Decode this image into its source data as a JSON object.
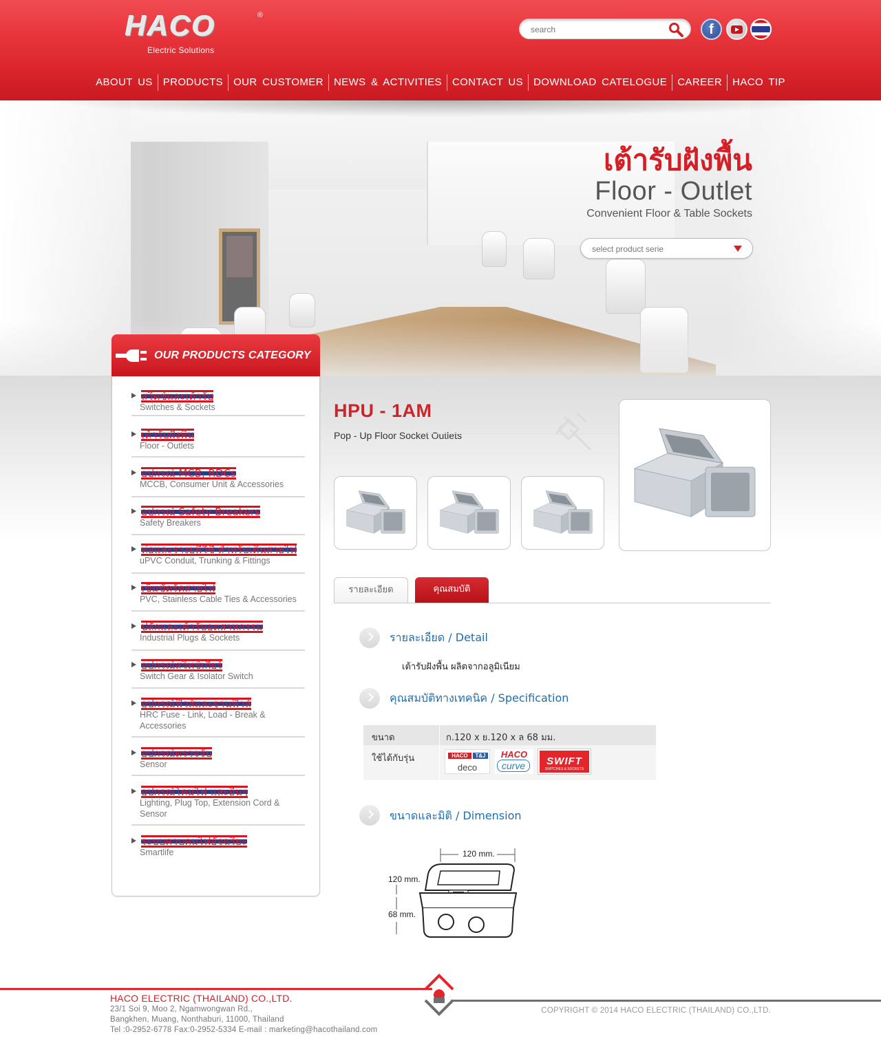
{
  "brand": {
    "logo_text": "HACO",
    "tagline": "Electric Solutions"
  },
  "search": {
    "placeholder": "search"
  },
  "nav": [
    "ABOUT US",
    "PRODUCTS",
    "OUR CUSTOMER",
    "NEWS & ACTIVITIES",
    "CONTACT US",
    "DOWNLOAD CATELOGUE",
    "CAREER",
    "HACO TIP"
  ],
  "hero": {
    "title_th": "เต้ารับฝังพื้น",
    "title_en": "Floor - Outlet",
    "subtitle": "Convenient Floor & Table Sockets",
    "select_label": "select product serie"
  },
  "sidebar": {
    "title": "OUR PRODUCTS CATEGORY",
    "items": [
      {
        "th": "สวิตช์และเต้ารับ",
        "en": "Switches & Sockets"
      },
      {
        "th": "เต้ารับฝังพื้น",
        "en": "Floor - Outlets"
      },
      {
        "th": "อุปกรณ์ MCB, RDCs",
        "en": "MCCB, Consumer Unit & Accessories"
      },
      {
        "th": "อุปกรณ์ Safety Breakers",
        "en": "Safety Breakers"
      },
      {
        "th": "ท่อและรางยูพีวีซี สำหรับเดินสายไฟ",
        "en": "uPVC Conduit, Trunking & Fittings"
      },
      {
        "th": "เข็มขัดรัดสายไฟ",
        "en": "PVC, Stainless Cable Ties & Accessories"
      },
      {
        "th": "ปลั๊กและเต้ารับอุตสาหกรรม",
        "en": "Industrial Plugs & Sockets"
      },
      {
        "th": "อุปกรณ์สวิทช์เกียร์",
        "en": "Switch Gear & Isolator Switch"
      },
      {
        "th": "อุปกรณ์ฟิวส์และฐานฟิวส์",
        "en": "HRC Fuse - Link, Load - Break & Accessories"
      },
      {
        "th": "อุปกรณ์ตรวจจับ",
        "en": "Sensor"
      },
      {
        "th": "อุปกรณ์โคมไฟ และอื่นๆ",
        "en": "Lighting, Plug Top, Extension Cord & Sensor"
      },
      {
        "th": "ระบบควบคุมไฟอัจฉริยะ",
        "en": "Smartlife"
      }
    ]
  },
  "product": {
    "code": "HPU - 1AM",
    "description": "Pop - Up Floor Socket Outlets"
  },
  "tabs": [
    "รายละเอียด",
    "คุณสมบัติ"
  ],
  "sections": {
    "detail_title": "รายละเอียด /  Detail",
    "detail_text": "เต้ารับฝังพื้น ผลิตจากอลูมิเนียม",
    "spec_title": "คุณสมบัติทางเทคนิค / Specification",
    "dimension_title": "ขนาดและมิติ / Dimension"
  },
  "spec": {
    "size_label": "ขนาด",
    "size_value": "ก.120 x ย.120 x ล 68 มม.",
    "compat_label": "ใช้ได้กับรุ่น",
    "brands": [
      "HACO",
      "T&J",
      "deco",
      "HACO",
      "curve",
      "SWIFT",
      "SWITCHES & SOCKETS"
    ]
  },
  "dimension": {
    "width": "120 mm.",
    "depth": "120 mm.",
    "height": "68 mm."
  },
  "footer": {
    "company": "HACO ELECTRIC (THAILAND) CO.,LTD.",
    "address1": "23/1 Soi 9, Moo 2, Ngamwongwan Rd.,",
    "address2": "Bangkhen, Muang, Nonthaburi, 11000, Thailand",
    "contact": "Tel :0-2952-6778 Fax:0-2952-5334 E-mail : marketing@hacothailand.com",
    "copyright": "COPYRIGHT © 2014 HACO ELECTRIC (THAILAND) CO.,LTD."
  },
  "colors": {
    "brand_red": "#e32a31",
    "link_blue": "#1f6eb0",
    "category_red": "#d41f27"
  }
}
